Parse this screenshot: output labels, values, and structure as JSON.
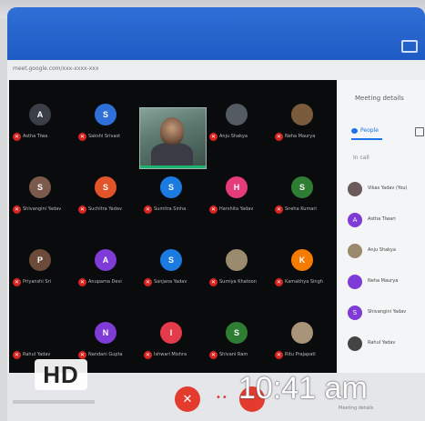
{
  "browser": {
    "url": "meet.google.com/xxx-xxxx-xxx"
  },
  "participants": [
    {
      "name": "Astha Tiwa",
      "initial": "A",
      "color": "#3a3f47"
    },
    {
      "name": "Sakshi Srivast",
      "initial": "S",
      "color": "#2f6fd8"
    },
    {
      "name": "Vikas Yadav",
      "initial": "",
      "color": ""
    },
    {
      "name": "Anju Shakya",
      "initial": "",
      "color": "#555b63"
    },
    {
      "name": "Neha Maurya",
      "initial": "",
      "color": "#7a5c3c"
    },
    {
      "name": "Shivangini Yadav",
      "initial": "S",
      "color": "#7c5a4b"
    },
    {
      "name": "Suchitra Yadav",
      "initial": "S",
      "color": "#e2542a"
    },
    {
      "name": "Sumitra Sinha",
      "initial": "S",
      "color": "#1b7be0"
    },
    {
      "name": "Harshita Yadav",
      "initial": "H",
      "color": "#e43b7a"
    },
    {
      "name": "Sneha Kumari",
      "initial": "S",
      "color": "#2e7d32"
    },
    {
      "name": "Priyanshi Sri",
      "initial": "P",
      "color": "#6b4a3a"
    },
    {
      "name": "Anupama Devi",
      "initial": "A",
      "color": "#7e3bd6"
    },
    {
      "name": "Sanjana Yadav",
      "initial": "S",
      "color": "#1b7be0"
    },
    {
      "name": "Sumiya Khatoon",
      "initial": "",
      "color": "#9a8b6e"
    },
    {
      "name": "Kamakhya Singh",
      "initial": "K",
      "color": "#f57c00"
    },
    {
      "name": "Rahul Yadav",
      "initial": "",
      "color": ""
    },
    {
      "name": "Nandani Gupta",
      "initial": "N",
      "color": "#7e3bd6"
    },
    {
      "name": "Ishwari Mishra",
      "initial": "I",
      "color": "#e43b4a"
    },
    {
      "name": "Shivani Ram",
      "initial": "S",
      "color": "#2e7d32"
    },
    {
      "name": "Ritu Prajapati",
      "initial": "",
      "color": "#a89478"
    }
  ],
  "side_panel": {
    "title": "Meeting details",
    "tab_people": "People",
    "subheader": "In call",
    "rows": [
      {
        "name": "Vikas Yadav (You)",
        "initial": "",
        "color": "#6b5a5a"
      },
      {
        "name": "Astha Tiwari",
        "initial": "A",
        "color": "#7e3bd6"
      },
      {
        "name": "Anju Shakya",
        "initial": "",
        "color": "#9a8b6e"
      },
      {
        "name": "Neha Maurya",
        "initial": "",
        "color": "#7e3bd6"
      },
      {
        "name": "Shivangini Yadav",
        "initial": "S",
        "color": "#7e3bd6"
      },
      {
        "name": "Rahul Yadav",
        "initial": "",
        "color": "#444"
      }
    ]
  },
  "controls": {
    "hd_label": "HD",
    "time": "10:41 am",
    "end_call_icon": "phone-hangup-icon"
  },
  "footer": {
    "right_text": "Meeting details"
  }
}
